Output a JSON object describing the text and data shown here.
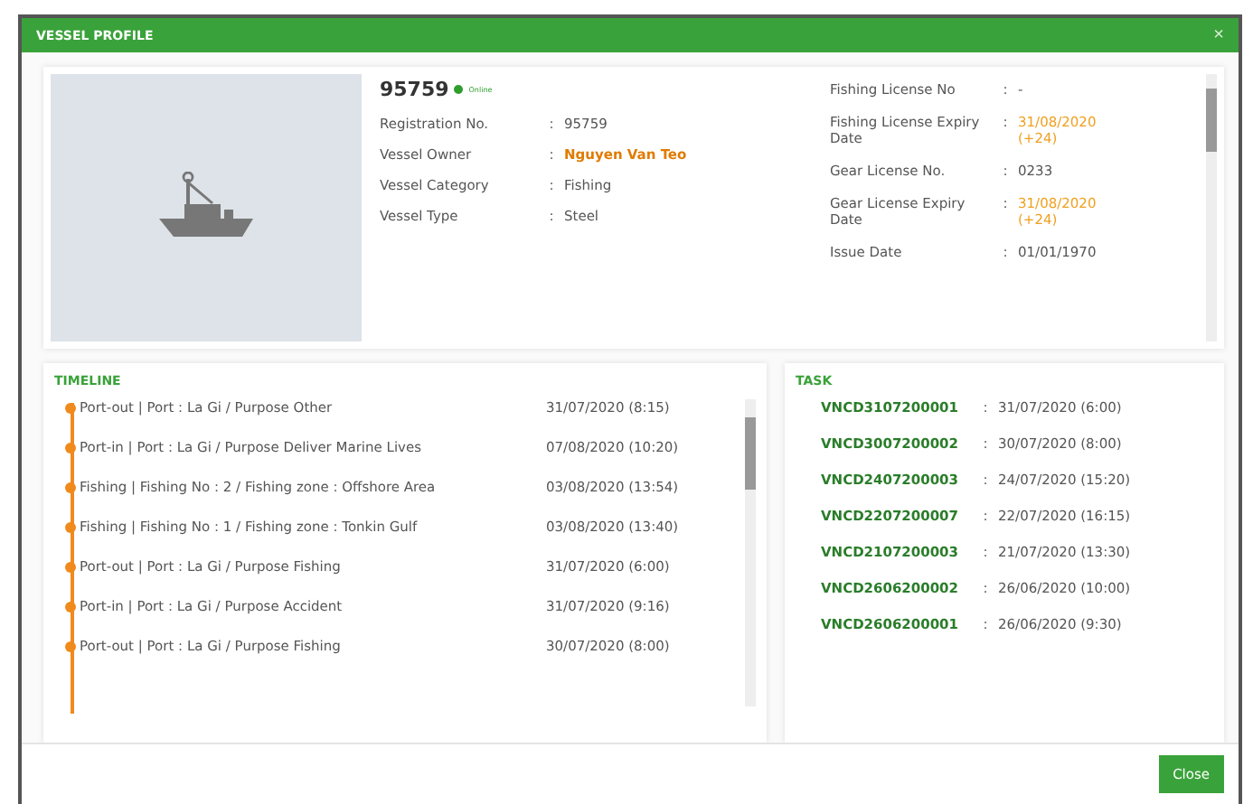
{
  "window": {
    "title": "VESSEL PROFILE",
    "close": "×"
  },
  "vessel": {
    "number": "95759",
    "status": "Online",
    "online": true
  },
  "details": [
    {
      "label": "Registration No.",
      "sep": ":",
      "value": "95759",
      "kind": "plain"
    },
    {
      "label": "Vessel Owner",
      "sep": ":",
      "value": "Nguyen Van Teo",
      "kind": "owner"
    },
    {
      "label": "Vessel Category",
      "sep": ":",
      "value": "Fishing",
      "kind": "plain"
    },
    {
      "label": "Vessel Type",
      "sep": ":",
      "value": "Steel",
      "kind": "plain"
    }
  ],
  "licenses": [
    {
      "label": "Fishing License No",
      "sep": ":",
      "value": "-",
      "kind": "plain"
    },
    {
      "label": "Fishing License Expiry Date",
      "sep": ":",
      "value": "31/08/2020 (+24)",
      "kind": "expiry"
    },
    {
      "label": "Gear License No.",
      "sep": ":",
      "value": "0233",
      "kind": "plain"
    },
    {
      "label": "Gear License Expiry Date",
      "sep": ":",
      "value": "31/08/2020 (+24)",
      "kind": "expiry"
    },
    {
      "label": "Issue Date",
      "sep": ":",
      "value": "01/01/1970",
      "kind": "plain"
    }
  ],
  "timeline": {
    "title": "TIMELINE",
    "events": [
      {
        "text": "Port-out | Port : La Gi / Purpose Other",
        "time": "31/07/2020 (8:15)"
      },
      {
        "text": "Port-in | Port : La Gi / Purpose Deliver Marine Lives",
        "time": "07/08/2020 (10:20)"
      },
      {
        "text": "Fishing | Fishing No : 2 / Fishing zone : Offshore Area",
        "time": "03/08/2020 (13:54)"
      },
      {
        "text": "Fishing | Fishing No : 1 / Fishing zone : Tonkin Gulf",
        "time": "03/08/2020 (13:40)"
      },
      {
        "text": "Port-out | Port : La Gi / Purpose Fishing",
        "time": "31/07/2020 (6:00)"
      },
      {
        "text": "Port-in | Port : La Gi / Purpose Accident",
        "time": "31/07/2020 (9:16)"
      },
      {
        "text": "Port-out | Port : La Gi / Purpose Fishing",
        "time": "30/07/2020 (8:00)"
      }
    ]
  },
  "task": {
    "title": "TASK",
    "items": [
      {
        "code": "VNCD3107200001",
        "sep": ":",
        "time": "31/07/2020 (6:00)"
      },
      {
        "code": "VNCD3007200002",
        "sep": ":",
        "time": "30/07/2020 (8:00)"
      },
      {
        "code": "VNCD2407200003",
        "sep": ":",
        "time": "24/07/2020 (15:20)"
      },
      {
        "code": "VNCD2207200007",
        "sep": ":",
        "time": "22/07/2020 (16:15)"
      },
      {
        "code": "VNCD2107200003",
        "sep": ":",
        "time": "21/07/2020 (13:30)"
      },
      {
        "code": "VNCD2606200002",
        "sep": ":",
        "time": "26/06/2020 (10:00)"
      },
      {
        "code": "VNCD2606200001",
        "sep": ":",
        "time": "26/06/2020 (9:30)"
      }
    ]
  },
  "buttons": {
    "close": "Close"
  }
}
